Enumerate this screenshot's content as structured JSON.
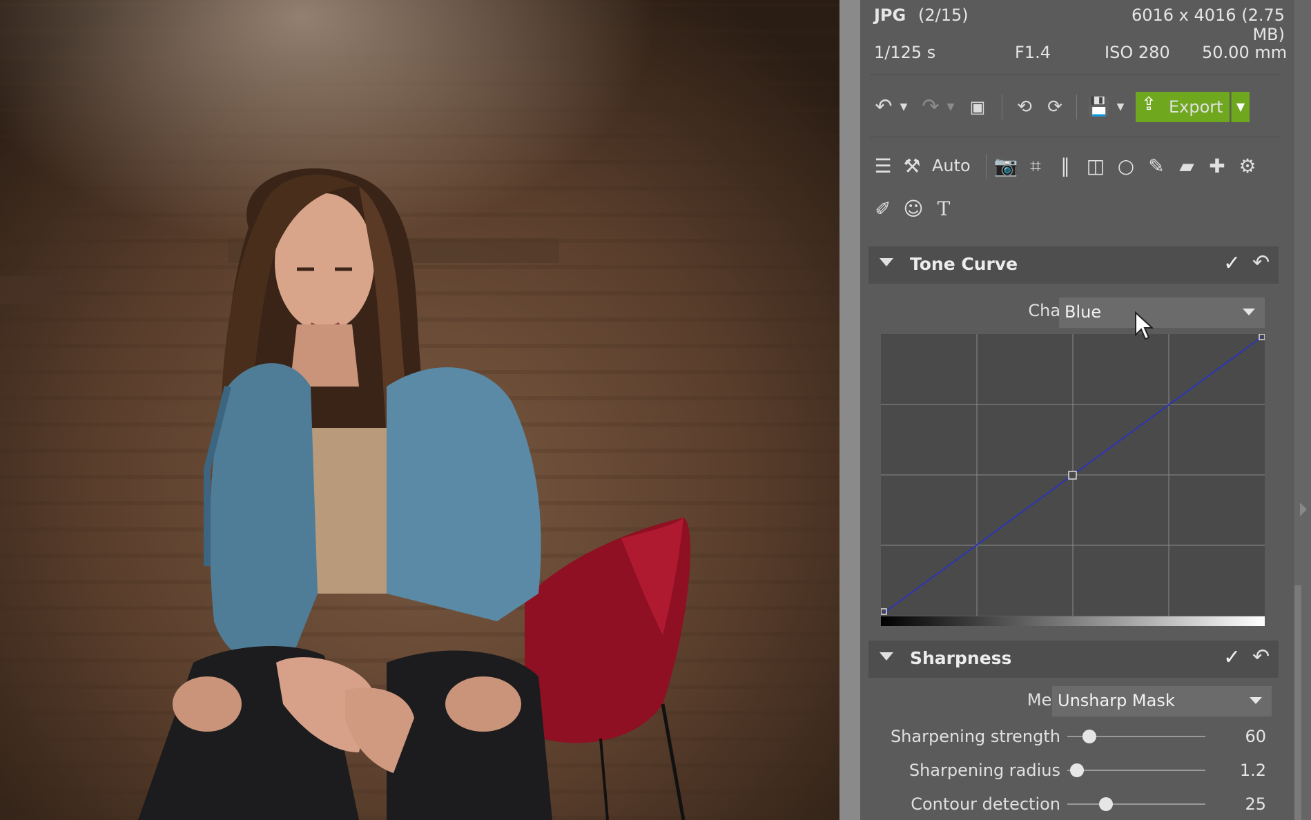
{
  "file": {
    "format": "JPG",
    "index": "(2/15)",
    "dimensions": "6016 x 4016 (2.75 MB)"
  },
  "exif": {
    "shutter": "1/125 s",
    "aperture": "F1.4",
    "iso": "ISO 280",
    "focal": "50.00 mm"
  },
  "toolbar": {
    "export_label": "Export",
    "auto_label": "Auto"
  },
  "tone_curve": {
    "title": "Tone Curve",
    "channel_label": "Channel:",
    "channel_value": "Blue",
    "curve_color": "#2b35b8"
  },
  "sharpness": {
    "title": "Sharpness",
    "method_label": "Method:",
    "method_value": "Unsharp Mask",
    "sliders": [
      {
        "label": "Sharpening strength",
        "value": "60",
        "fraction": 0.16
      },
      {
        "label": "Sharpening radius",
        "value": "1.2",
        "fraction": 0.07
      },
      {
        "label": "Contour detection",
        "value": "25",
        "fraction": 0.28
      }
    ]
  },
  "colors": {
    "export_green": "#6fa81f",
    "panel_bg": "#5b5b5b"
  }
}
